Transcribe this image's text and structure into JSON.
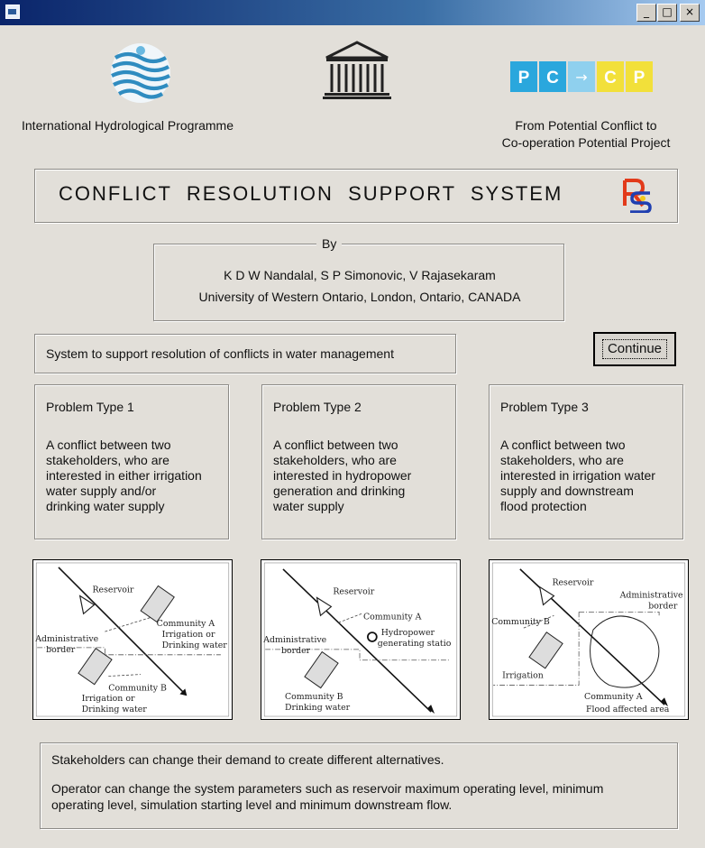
{
  "header": {
    "left_caption": "International Hydrological Programme",
    "right_caption_line1": "From Potential Conflict to",
    "right_caption_line2": "Co-operation Potential Project",
    "pccp_letters": [
      "P",
      "C",
      "→",
      "C",
      "P"
    ],
    "unesco_logo_text": "UNESCO"
  },
  "title": {
    "text": "CONFLICT  RESOLUTION  SUPPORT  SYSTEM",
    "logo_letters": "RS"
  },
  "authors": {
    "legend": "By",
    "line1": "K D W Nandalal, S P Simonovic,  V Rajasekaram",
    "line2": "University of Western Ontario, London, Ontario, CANADA"
  },
  "system_description": "System to support resolution of conflicts in water management",
  "continue_button": "Continue",
  "problems": [
    {
      "title": "Problem Type 1",
      "desc_lines": [
        "A conflict  between two",
        "stakeholders, who are",
        "interested in either irrigation",
        "water supply and/or",
        "drinking water supply"
      ],
      "figure": {
        "reservoir": "Reservoir",
        "community_a": [
          "Community A",
          "Irrigation or",
          "Drinking water"
        ],
        "admin": [
          "Administrative",
          "border"
        ],
        "community_b": [
          "Community B",
          "Irrigation or",
          "Drinking water"
        ]
      }
    },
    {
      "title": "Problem Type 2",
      "desc_lines": [
        "A conflict between two",
        "stakeholders, who are",
        "interested in hydropower",
        "generation and drinking",
        "water supply"
      ],
      "figure": {
        "reservoir": "Reservoir",
        "community_a": "Community A",
        "hydropower": [
          "Hydropower",
          "generating statio"
        ],
        "admin": [
          "Administrative",
          "border"
        ],
        "community_b": [
          "Community B",
          "Drinking water"
        ]
      }
    },
    {
      "title": "Problem Type 3",
      "desc_lines": [
        "A conflict between two",
        "stakeholders, who are",
        "interested in irrigation water",
        "supply and downstream",
        "flood protection"
      ],
      "figure": {
        "reservoir": "Reservoir",
        "admin": [
          "Administrative",
          "border"
        ],
        "community_b": "Community B",
        "irrigation": "Irrigation",
        "community_a": "Community A",
        "flood": "Flood affected area"
      }
    }
  ],
  "notes": {
    "line1": "Stakeholders can change their demand to create different alternatives.",
    "line2a": "Operator can change the system parameters such as reservoir maximum operating level, minimum",
    "line2b": "operating level, simulation starting level and minimum downstream flow."
  },
  "window_buttons": {
    "minimize": "_",
    "maximize": "□",
    "close": "×"
  },
  "colors": {
    "titlebar": "#0a246a",
    "window_bg": "#e2dfd9",
    "pccp_blue": "#2aa7dd",
    "pccp_yellow": "#f2e03a",
    "rs_red": "#e23a1a",
    "rs_blue": "#1f3fb0"
  }
}
